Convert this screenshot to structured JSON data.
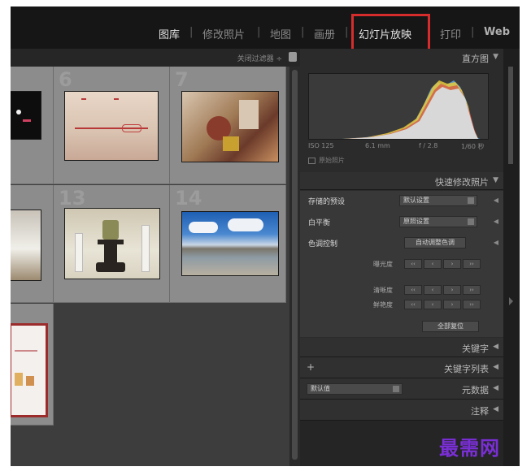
{
  "topbar": {
    "modules": [
      {
        "label": "图库",
        "active": true
      },
      {
        "label": "修改照片",
        "active": false
      },
      {
        "label": "地图",
        "active": false
      },
      {
        "label": "画册",
        "active": false
      },
      {
        "label": "幻灯片放映",
        "active": true
      },
      {
        "label": "打印",
        "active": false
      },
      {
        "label": "Web",
        "active": false
      }
    ],
    "separator": "|"
  },
  "grid": {
    "filter_label": "关闭过滤器 ÷",
    "cell_numbers": [
      "6",
      "7",
      "13",
      "14"
    ]
  },
  "panel": {
    "histogram": {
      "title": "直方图",
      "iso": "ISO 125",
      "focal": "6.1 mm",
      "aperture": "f / 2.8",
      "shutter": "1/60 秒",
      "original_label": "原始照片"
    },
    "quick_develop": {
      "title": "快速修改照片",
      "saved_preset_label": "存储的预设",
      "saved_preset_value": "默认设置",
      "white_balance_label": "白平衡",
      "white_balance_value": "原照设置",
      "tone_label": "色调控制",
      "auto_tone_button": "自动调整色调",
      "exposure_label": "曝光度",
      "clarity_label": "清晰度",
      "vibrance_label": "鲜艳度",
      "reset_button": "全部复位"
    },
    "keywording_title": "关键字",
    "keyword_list_title": "关键字列表",
    "keyword_list_plus": "+",
    "metadata_title": "元数据",
    "metadata_preset": "默认值",
    "comments_title": "注释"
  },
  "watermark": "最需网"
}
